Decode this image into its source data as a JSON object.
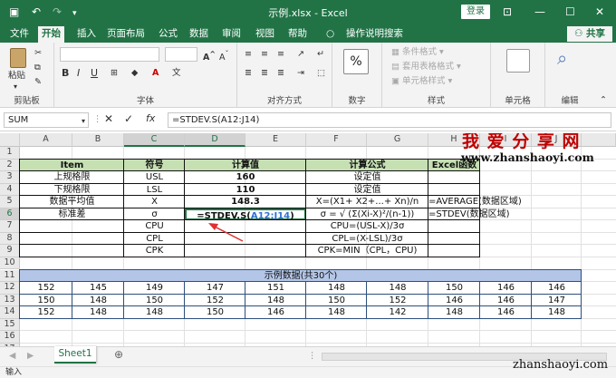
{
  "titlebar": {
    "title": "示例.xlsx  -  Excel",
    "login": "登录"
  },
  "tabs": [
    "文件",
    "开始",
    "插入",
    "页面布局",
    "公式",
    "数据",
    "审阅",
    "视图",
    "帮助",
    "操作说明搜索"
  ],
  "share": "共享",
  "ribbon": {
    "clipboard": {
      "paste": "粘贴",
      "label": "剪贴板"
    },
    "font": {
      "label": "字体"
    },
    "alignment": {
      "label": "对齐方式"
    },
    "number": {
      "format": "%",
      "label": "数字"
    },
    "styles": {
      "conditional": "条件格式",
      "table": "套用表格格式",
      "cell": "单元格样式",
      "label": "样式"
    },
    "cells": {
      "label": "单元格"
    },
    "editing": {
      "label": "编辑"
    }
  },
  "formula_bar": {
    "name_box": "SUM",
    "formula": "=STDEV.S(A12:J14)",
    "fx": "fx"
  },
  "columns": [
    "A",
    "B",
    "C",
    "D",
    "E",
    "F",
    "G",
    "H",
    "I",
    "J"
  ],
  "rows": [
    "1",
    "2",
    "3",
    "4",
    "5",
    "6",
    "7",
    "8",
    "9",
    "10",
    "11",
    "12",
    "13",
    "14",
    "15",
    "16",
    "17"
  ],
  "watermark": {
    "brand": "我 爱 分 享 网",
    "url": "www.zhanshaoyi.com",
    "footer": "zhanshaoyi.com"
  },
  "table": {
    "header": {
      "item": "Item",
      "symbol": "符号",
      "calc": "计算值",
      "formula": "计算公式",
      "excel": "Excel函数"
    },
    "rows": [
      {
        "item": "上规格限",
        "symbol": "USL",
        "calc": "160",
        "formula": "设定值",
        "excel": ""
      },
      {
        "item": "下规格限",
        "symbol": "LSL",
        "calc": "110",
        "formula": "设定值",
        "excel": ""
      },
      {
        "item": "数据平均值",
        "symbol": "X",
        "calc": "148.3",
        "formula": "X=(X1+ X2+...+ Xn)/n",
        "excel": "=AVERAGE(数据区域)"
      },
      {
        "item": "标准差",
        "symbol": "σ",
        "calc_prefix": "=STDEV.S(",
        "calc_ref": "A12:J14",
        "calc_suffix": ")",
        "formula": "σ = √ (Σ(Xi-X)²/(n-1))",
        "excel": "=STDEV(数据区域)"
      },
      {
        "item": "",
        "symbol": "CPU",
        "calc": "",
        "formula": "CPU=(USL-X)/3σ",
        "excel": ""
      },
      {
        "item": "",
        "symbol": "CPL",
        "calc": "",
        "formula": "CPL=(X-LSL)/3σ",
        "excel": ""
      },
      {
        "item": "",
        "symbol": "CPK",
        "calc": "",
        "formula": "CPK=MIN（CPL，CPU)",
        "excel": ""
      }
    ]
  },
  "sample": {
    "title": "示例数据(共30个)",
    "rows": [
      [
        "152",
        "145",
        "149",
        "147",
        "151",
        "148",
        "148",
        "150",
        "146",
        "146"
      ],
      [
        "150",
        "148",
        "150",
        "152",
        "148",
        "150",
        "152",
        "146",
        "146",
        "147"
      ],
      [
        "152",
        "148",
        "148",
        "150",
        "146",
        "148",
        "142",
        "148",
        "146",
        "148"
      ]
    ]
  },
  "sheet_tab": "Sheet1",
  "status": "输入",
  "colors": {
    "excel_green": "#217346",
    "header_fill": "#c6e0b4",
    "sample_fill": "#b4c6e7",
    "ref_blue": "#2f6fd6",
    "watermark_red": "#c00000",
    "arrow_red": "#e03030"
  }
}
